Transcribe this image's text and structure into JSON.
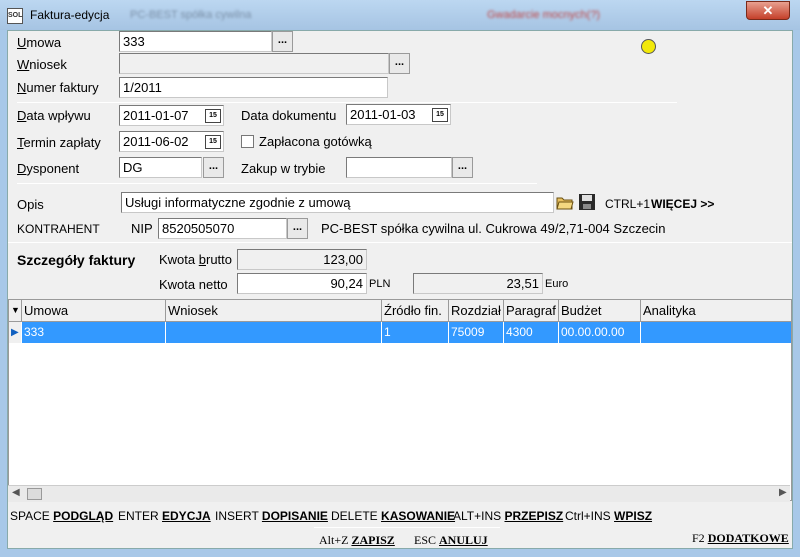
{
  "window": {
    "title": "Faktura-edycja",
    "app_icon": "SOL",
    "title_blur_left": "PC-BEST spółka cywilna",
    "title_blur_right": "Gwadarcie mocnych(?)",
    "close_label": "✕"
  },
  "form": {
    "umowa_label": "Umowa",
    "umowa_value": "333",
    "wniosek_label": "Wniosek",
    "wniosek_value": "",
    "numer_label": "Numer faktury",
    "numer_value": "1/2011",
    "data_wplywu_label": "Data wpływu",
    "data_wplywu_value": "2011-01-07",
    "data_dokumentu_label": "Data dokumentu",
    "data_dokumentu_value": "2011-01-03",
    "termin_label": "Termin zapłaty",
    "termin_value": "2011-06-02",
    "zaplacona_label": "Zapłacona gotówką",
    "dysponent_label": "Dysponent",
    "dysponent_value": "DG",
    "zakup_label": "Zakup w trybie",
    "zakup_value": "",
    "opis_label": "Opis",
    "opis_value": "Usługi informatyczne zgodnie z umową",
    "ctrl_hint": "CTRL+1",
    "wiecej_label": "WIĘCEJ >>",
    "kontrahent_label": "KONTRAHENT",
    "nip_label": "NIP",
    "nip_value": "8520505070",
    "kontrahent_value": "PC-BEST spółka cywilna ul. Cukrowa 49/2,71-004 Szczecin",
    "ellipsis": "...",
    "cal_icon": "15"
  },
  "details": {
    "title": "Szczegóły faktury",
    "brutto_label": "Kwota brutto",
    "brutto_value": "123,00",
    "netto_label": "Kwota netto",
    "netto_value": "90,24",
    "currency_pln": "PLN",
    "euro_value": "23,51",
    "currency_euro": "Euro"
  },
  "grid": {
    "columns": [
      "Umowa",
      "Wniosek",
      "Źródło fin.",
      "Rozdział",
      "Paragraf",
      "Budżet",
      "Analityka"
    ],
    "rows": [
      {
        "umowa": "333",
        "wniosek": "",
        "zrodlo": "1",
        "rozdzial": "75009",
        "paragraf": "4300",
        "budzet": "00.00.00.00",
        "analityka": ""
      }
    ]
  },
  "shortcuts": {
    "space": "SPACE",
    "podglad": "PODGLĄD",
    "enter": "ENTER",
    "edycja": "EDYCJA",
    "insert": "INSERT",
    "dopisanie": "DOPISANIE",
    "delete": "DELETE",
    "kasowanie": "KASOWANIE",
    "altins": "ALT+INS",
    "przepisz": "PRZEPISZ",
    "ctrlins": "Ctrl+INS",
    "wpisz": "WPISZ",
    "altz": "Alt+Z",
    "zapisz": "ZAPISZ",
    "esc": "ESC",
    "anuluj": "ANULUJ",
    "f2": "F2",
    "dodatkowe": "DODATKOWE"
  },
  "colors": {
    "selection": "#3399ff",
    "indicator": "#f2e90a"
  }
}
